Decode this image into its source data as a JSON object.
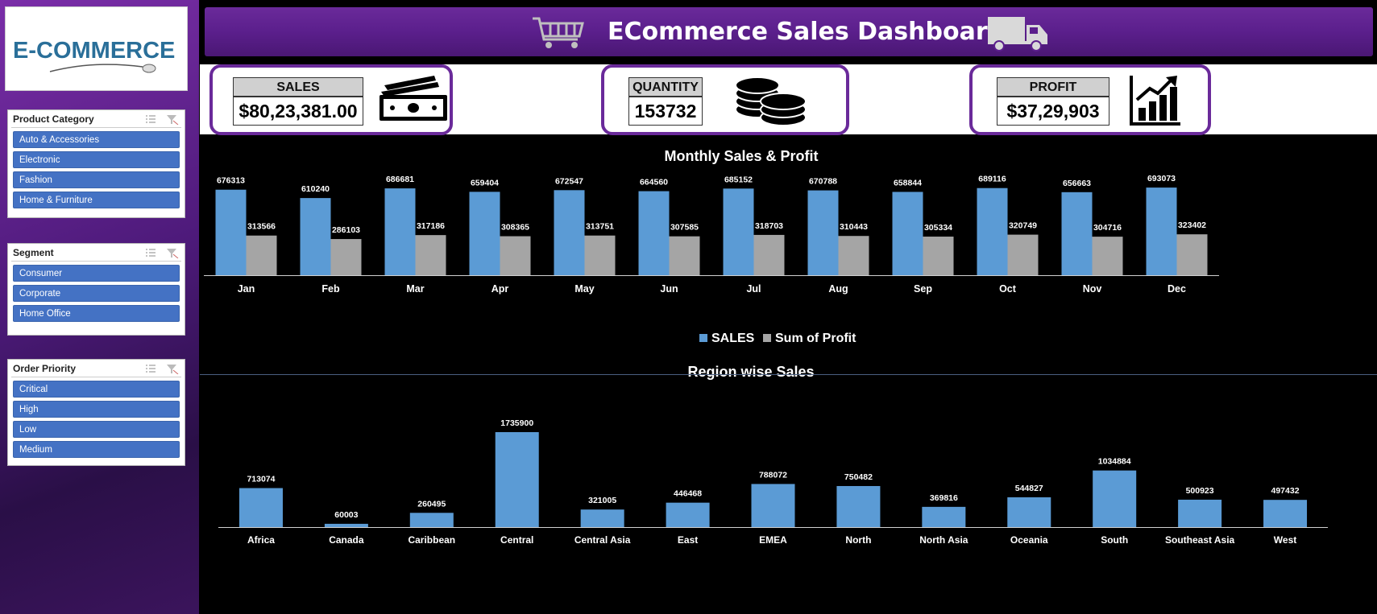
{
  "header": {
    "title": "ECommerce Sales Dashboard"
  },
  "logo": {
    "text": "E-COMMERCE"
  },
  "slicers": [
    {
      "title": "Product Category",
      "items": [
        "Auto & Accessories",
        "Electronic",
        "Fashion",
        "Home & Furniture"
      ]
    },
    {
      "title": "Segment",
      "items": [
        "Consumer",
        "Corporate",
        "Home Office"
      ]
    },
    {
      "title": "Order Priority",
      "items": [
        "Critical",
        "High",
        "Low",
        "Medium"
      ]
    }
  ],
  "kpis": {
    "sales": {
      "label": "SALES",
      "value": "$80,23,381.00",
      "icon": "money-icon"
    },
    "quantity": {
      "label": "QUANTITY",
      "value": "153732",
      "icon": "coins-icon"
    },
    "profit": {
      "label": "PROFIT",
      "value": "$37,29,903",
      "icon": "bar-chart-growth-icon"
    }
  },
  "colors": {
    "sales": "#5b9bd5",
    "profit": "#a5a5a5",
    "purple": "#6a2a9a",
    "slicer_item": "#4472c4"
  },
  "chart_data": [
    {
      "type": "bar",
      "title": "Monthly Sales & Profit",
      "categories": [
        "Jan",
        "Feb",
        "Mar",
        "Apr",
        "May",
        "Jun",
        "Jul",
        "Aug",
        "Sep",
        "Oct",
        "Nov",
        "Dec"
      ],
      "series": [
        {
          "name": "SALES",
          "values": [
            676313,
            610240,
            686681,
            659404,
            672547,
            664560,
            685152,
            670788,
            658844,
            689116,
            656663,
            693073
          ]
        },
        {
          "name": "Sum of Profit",
          "values": [
            313566,
            286103,
            317186,
            308365,
            313751,
            307585,
            318703,
            310443,
            305334,
            320749,
            304716,
            323402
          ]
        }
      ],
      "legend": "bottom",
      "ylim": [
        0,
        800000
      ],
      "grid": false
    },
    {
      "type": "bar",
      "title": "Region wise Sales",
      "categories": [
        "Africa",
        "Canada",
        "Caribbean",
        "Central",
        "Central Asia",
        "East",
        "EMEA",
        "North",
        "North Asia",
        "Oceania",
        "South",
        "Southeast Asia",
        "West"
      ],
      "values": [
        713074,
        60003,
        260495,
        1735900,
        321005,
        446468,
        788072,
        750482,
        369816,
        544827,
        1034884,
        500923,
        497432
      ],
      "ylim": [
        0,
        1800000
      ],
      "grid": false
    }
  ]
}
